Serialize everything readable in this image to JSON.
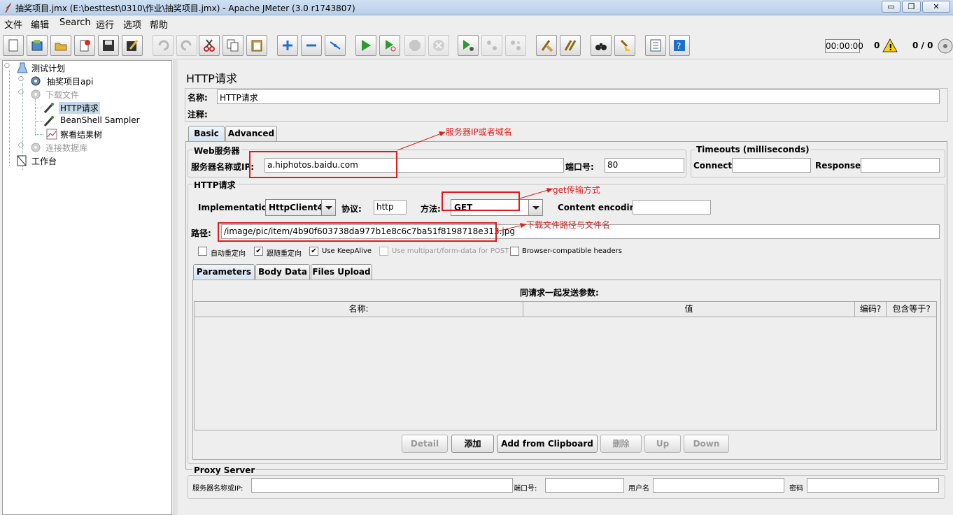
{
  "window": {
    "title": "抽奖项目.jmx (E:\\besttest\\0310\\作业\\抽奖项目.jmx) - Apache JMeter (3.0 r1743807)",
    "minimize": "▭",
    "restore": "❐",
    "close": "✕"
  },
  "menu": [
    "文件",
    "编辑",
    "Search",
    "运行",
    "选项",
    "帮助"
  ],
  "status": {
    "timer": "00:00:00",
    "warnings": "0",
    "threads": "0 / 0"
  },
  "tree": {
    "items": [
      {
        "label": "测试计划",
        "icon": "test-plan-icon"
      },
      {
        "label": "抽奖项目api",
        "icon": "thread-group-icon"
      },
      {
        "label": "下载文件",
        "icon": "thread-group-disabled-icon"
      },
      {
        "label": "HTTP请求",
        "icon": "sampler-icon"
      },
      {
        "label": "BeanShell Sampler",
        "icon": "sampler-icon"
      },
      {
        "label": "察看结果树",
        "icon": "listener-icon"
      },
      {
        "label": "连接数据库",
        "icon": "thread-group-disabled-icon"
      },
      {
        "label": "工作台",
        "icon": "workbench-icon"
      }
    ]
  },
  "panel": {
    "heading": "HTTP请求",
    "name_label": "名称:",
    "name_value": "HTTP请求",
    "comment_label": "注释:",
    "tabs": [
      "Basic",
      "Advanced"
    ],
    "web_server": {
      "legend": "Web服务器",
      "server_label": "服务器名称或IP:",
      "server_value": "a.hiphotos.baidu.com",
      "port_label": "端口号:",
      "port_value": "80"
    },
    "timeouts": {
      "legend": "Timeouts (milliseconds)",
      "connect_label": "Connect:",
      "response_label": "Response:"
    },
    "http_request": {
      "legend": "HTTP请求",
      "impl_label": "Implementation:",
      "impl_value": "HttpClient4",
      "protocol_label": "协议:",
      "protocol_value": "http",
      "method_label": "方法:",
      "method_value": "GET",
      "encoding_label": "Content encoding:",
      "path_label": "路径:",
      "path_value": "/image/pic/item/4b90f603738da977b1e8c6c7ba51f8198718e313.jpg"
    },
    "checkboxes": [
      {
        "label": "自动重定向",
        "checked": false
      },
      {
        "label": "跟随重定向",
        "checked": true
      },
      {
        "label": "Use KeepAlive",
        "checked": true
      },
      {
        "label": "Use multipart/form-data for POST",
        "checked": false
      },
      {
        "label": "Browser-compatible headers",
        "checked": false
      }
    ],
    "subtabs": [
      "Parameters",
      "Body Data",
      "Files Upload"
    ],
    "params": {
      "caption": "同请求一起发送参数:",
      "columns": [
        "名称:",
        "值",
        "编码?",
        "包含等于?"
      ]
    },
    "buttons": [
      "Detail",
      "添加",
      "Add from Clipboard",
      "删除",
      "Up",
      "Down"
    ],
    "proxy": {
      "legend": "Proxy Server",
      "server_label": "服务器名称或IP:",
      "port_label": "端口号:",
      "user_label": "用户名",
      "password_label": "密码"
    }
  },
  "annotations": {
    "server": "服务器IP或者域名",
    "method": "get传输方式",
    "path": "下载文件路径与文件名"
  }
}
